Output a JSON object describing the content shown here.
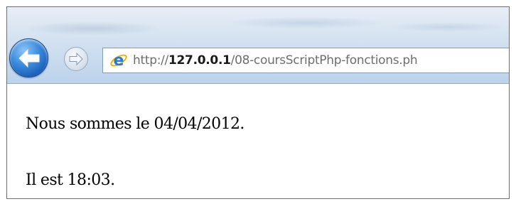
{
  "browser": {
    "back_button": {
      "icon": "back-arrow-icon"
    },
    "forward_button": {
      "icon": "forward-arrow-icon"
    },
    "address_bar": {
      "favicon": "ie-logo-icon",
      "url_scheme": "http://",
      "url_host": "127.0.0.1",
      "url_path": "/08-coursScriptPhp-fonctions.ph"
    }
  },
  "page": {
    "date_line": "Nous sommes le 04/04/2012.",
    "time_line": "Il est 18:03."
  },
  "colors": {
    "back_button": "#2f7ad6",
    "url_text": "#6d6d6d",
    "url_host": "#1a1a1a"
  }
}
